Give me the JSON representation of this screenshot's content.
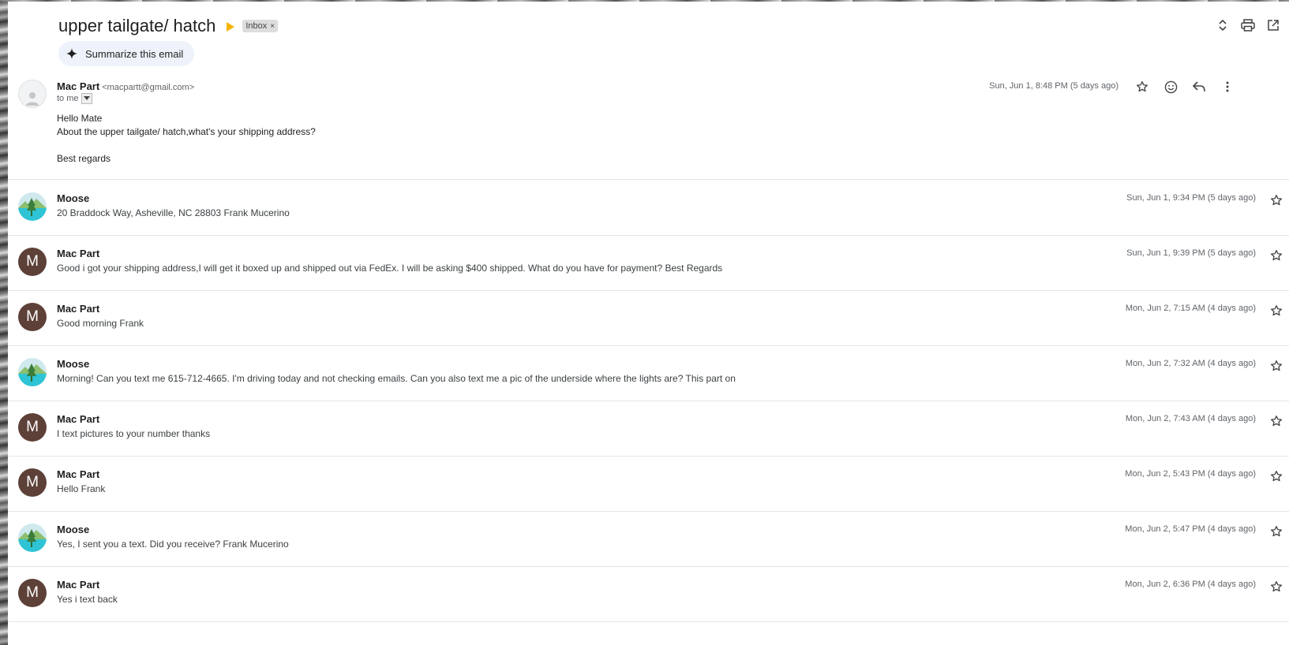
{
  "subject": "upper tailgate/ hatch",
  "label": "Inbox",
  "label_remove": "×",
  "summarize_label": "Summarize this email",
  "first_message": {
    "sender": "Mac Part",
    "email": "<macpartt@gmail.com>",
    "to": "to me",
    "date": "Sun, Jun 1, 8:48 PM (5 days ago)",
    "body": [
      "Hello Mate",
      "About the upper tailgate/ hatch,what's your shipping address?",
      "",
      "Best regards"
    ]
  },
  "messages": [
    {
      "sender": "Moose",
      "avatar": "landscape",
      "snippet": "20 Braddock Way, Asheville, NC 28803 Frank Mucerino",
      "date": "Sun, Jun 1, 9:34 PM (5 days ago)"
    },
    {
      "sender": "Mac Part",
      "avatar": "M",
      "snippet": "Good i got your shipping address,I will get it boxed up and shipped out via FedEx. I will be asking $400 shipped. What do you have for payment? Best Regards",
      "date": "Sun, Jun 1, 9:39 PM (5 days ago)"
    },
    {
      "sender": "Mac Part",
      "avatar": "M",
      "snippet": "Good morning Frank",
      "date": "Mon, Jun 2, 7:15 AM (4 days ago)"
    },
    {
      "sender": "Moose",
      "avatar": "landscape",
      "snippet": "Morning! Can you text me 615-712-4665. I'm driving today and not checking emails. Can you also text me a pic of the underside where the lights are? This part on",
      "date": "Mon, Jun 2, 7:32 AM (4 days ago)"
    },
    {
      "sender": "Mac Part",
      "avatar": "M",
      "snippet": "I text pictures to your number thanks",
      "date": "Mon, Jun 2, 7:43 AM (4 days ago)"
    },
    {
      "sender": "Mac Part",
      "avatar": "M",
      "snippet": "Hello Frank",
      "date": "Mon, Jun 2, 5:43 PM (4 days ago)"
    },
    {
      "sender": "Moose",
      "avatar": "landscape",
      "snippet": "Yes, I sent you a text. Did you receive? Frank Mucerino",
      "date": "Mon, Jun 2, 5:47 PM (4 days ago)"
    },
    {
      "sender": "Mac Part",
      "avatar": "M",
      "snippet": "Yes i text back",
      "date": "Mon, Jun 2, 6:36 PM (4 days ago)"
    }
  ],
  "icons": {
    "top": [
      "expand-collapse-icon",
      "print-icon",
      "open-new-window-icon"
    ],
    "message_actions": [
      "star-icon",
      "emoji-react-icon",
      "reply-icon",
      "more-options-icon"
    ]
  },
  "colors": {
    "avatar_m": "#5d4037",
    "important": "#f4b400",
    "summarize_bg": "#eef3fb"
  }
}
